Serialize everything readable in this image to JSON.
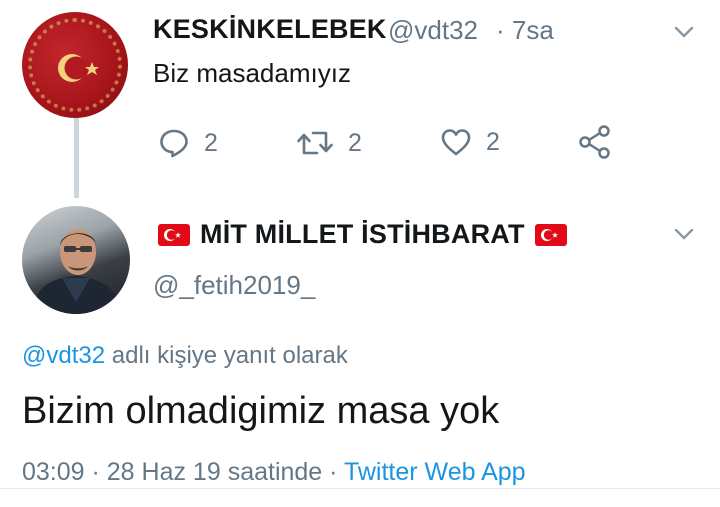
{
  "tweet1": {
    "display_name": "KESKİNKELEBEK",
    "handle": "@vdt32",
    "time": "· 7sa",
    "text": "Biz masadamıyız",
    "reply_count": "2",
    "retweet_count": "2",
    "like_count": "2"
  },
  "tweet2": {
    "display_name": "MİT MİLLET İSTİHBARAT",
    "handle": "@_fetih2019_",
    "reply_to_handle": "@vdt32",
    "reply_to_suffix": " adlı kişiye yanıt olarak",
    "text": "Bizim olmadigimiz masa yok",
    "timestamp": "03:09 · 28 Haz 19 saatinde · ",
    "source": "Twitter Web App"
  },
  "colors": {
    "accent": "#1b95e0",
    "secondary_text": "#657786",
    "flag_red": "#e30a17"
  },
  "icons": [
    "reply-icon",
    "retweet-icon",
    "like-icon",
    "share-icon",
    "chevron-down-icon",
    "turkish-flag-icon"
  ]
}
